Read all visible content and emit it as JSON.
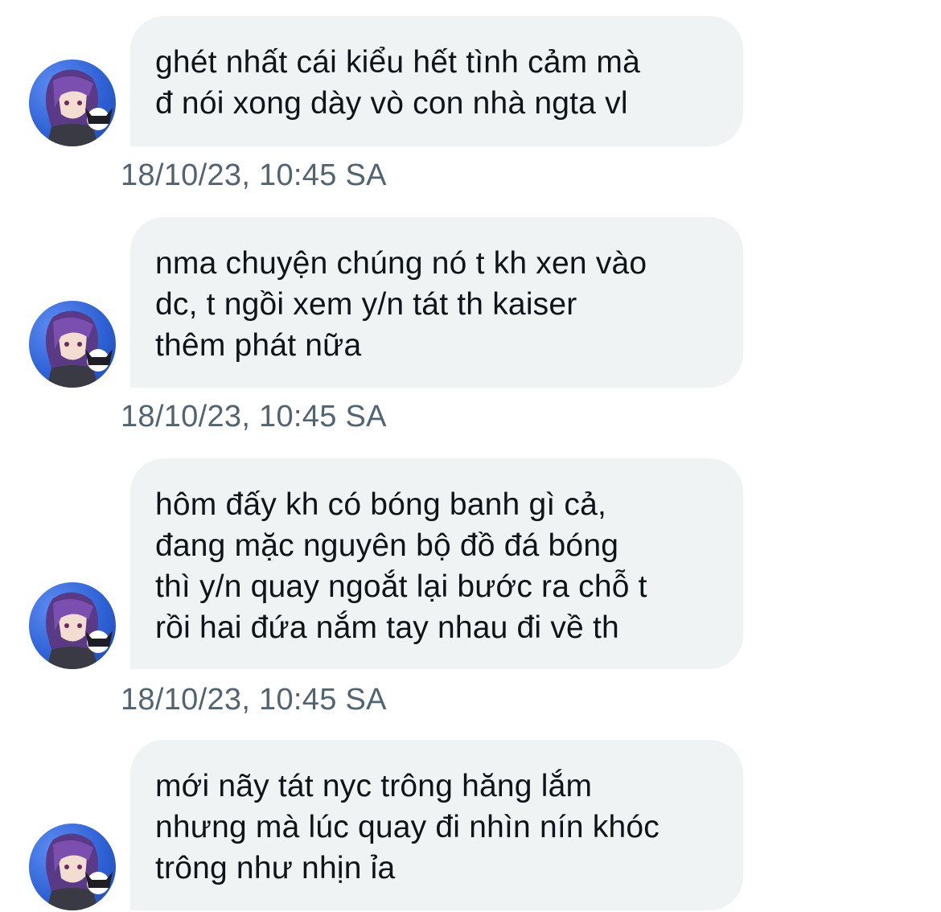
{
  "messages": [
    {
      "lines": [
        "ghét nhất cái kiểu hết tình cảm mà",
        "đ nói xong dày vò con nhà ngta vl"
      ],
      "timestamp": "18/10/23, 10:45 SA"
    },
    {
      "lines": [
        "nma chuyện chúng nó t kh xen vào",
        "dc, t ngồi xem y/n tát th kaiser",
        "thêm phát nữa"
      ],
      "timestamp": "18/10/23, 10:45 SA"
    },
    {
      "lines": [
        "hôm đấy kh có bóng banh gì cả,",
        "đang mặc nguyên bộ đồ đá bóng",
        "thì y/n quay ngoắt lại bước ra chỗ t",
        "rồi hai đứa nắm tay nhau đi về th"
      ],
      "timestamp": "18/10/23, 10:45 SA"
    },
    {
      "lines": [
        "mới nãy tát nyc trông hăng lắm",
        "nhưng mà lúc quay đi nhìn nín khóc",
        "trông như nhịn ỉa"
      ]
    }
  ],
  "colors": {
    "bubble_bg": "#eff3f4",
    "text": "#0f1419",
    "timestamp": "#536471",
    "avatar_bg": "#2f62d6"
  },
  "icons": {
    "avatar": "anime-character-avatar-icon"
  }
}
